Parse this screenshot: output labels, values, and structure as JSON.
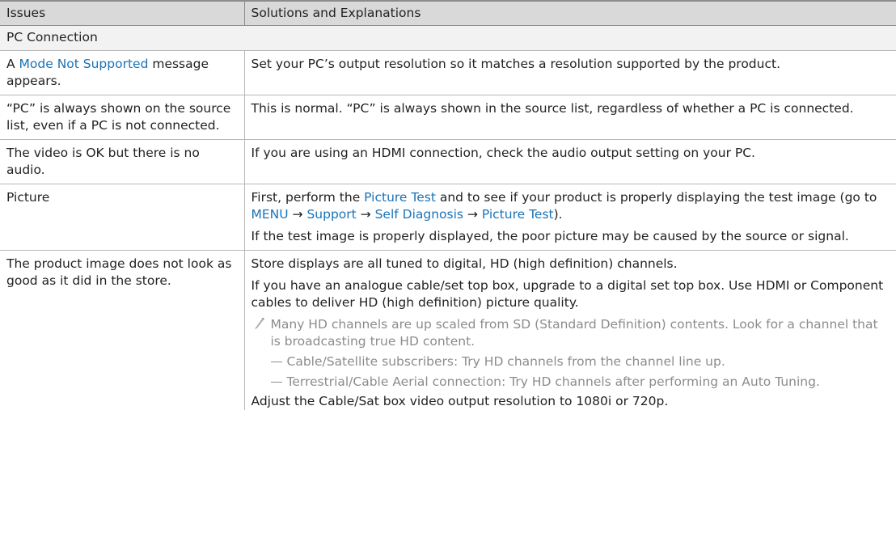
{
  "header": {
    "issues": "Issues",
    "solutions": "Solutions and Explanations"
  },
  "section": {
    "pc_connection": "PC Connection"
  },
  "rows": {
    "mode": {
      "issue_pre": "A ",
      "issue_link": "Mode Not Supported",
      "issue_post": " message appears.",
      "solution": "Set your PC’s output resolution so it matches a resolution supported by the product."
    },
    "pc_shown": {
      "issue": "“PC” is always shown on the source list, even if a PC is not connected.",
      "solution": "This is normal. “PC” is always shown in the source list, regardless of whether a PC is connected."
    },
    "audio": {
      "issue": "The video is OK but there is no audio.",
      "solution": "If you are using an HDMI connection, check the audio output setting on your PC."
    },
    "picture": {
      "issue": "Picture",
      "p1_a": "First, perform the ",
      "p1_link": "Picture Test",
      "p1_b": " and to see if your product is properly displaying the test image (go to ",
      "menu_menu": "MENU",
      "arrow": " → ",
      "menu_support": "Support",
      "menu_self_diagnosis": "Self Diagnosis",
      "menu_picture_test": "Picture Test",
      "p1_c": ").",
      "p2": "If the test image is properly displayed, the poor picture may be caused by the source or signal."
    },
    "store": {
      "issue": "The product image does not look as good as it did in the store.",
      "p1": "Store displays are all tuned to digital, HD (high definition) channels.",
      "p2": "If you have an analogue cable/set top box, upgrade to a digital set top box. Use HDMI or Component cables to deliver HD (high definition) picture quality.",
      "note": "Many HD channels are up scaled from SD (Standard Definition) contents. Look for a channel that is broadcasting true HD content.",
      "sub1": "Cable/Satellite subscribers: Try HD channels from the channel line up.",
      "sub2": "Terrestrial/Cable Aerial connection: Try HD channels after performing an Auto Tuning.",
      "p3": "Adjust the Cable/Sat box video output resolution to 1080i or 720p."
    }
  },
  "colors": {
    "link": "#1a73b8",
    "header_bg": "#d9d9d9",
    "section_bg": "#f2f2f2",
    "note_text": "#8c8c8c",
    "border": "#b8b8b8"
  }
}
